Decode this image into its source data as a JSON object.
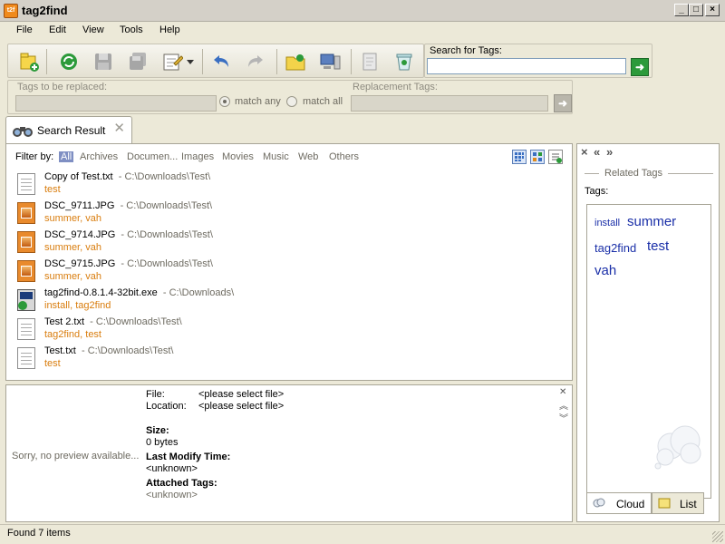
{
  "window": {
    "title": "tag2find",
    "controls": [
      "_",
      "□",
      "×"
    ]
  },
  "menu": {
    "items": [
      "File",
      "Edit",
      "View",
      "Tools",
      "Help"
    ]
  },
  "toolbar": {
    "buttons": [
      "new-tag-icon",
      "refresh-icon",
      "save-icon",
      "save-all-icon",
      "edit-icon",
      "undo-icon",
      "redo-icon",
      "open-folder-icon",
      "computer-icon",
      "document-icon",
      "recycle-bin-icon"
    ],
    "search_label": "Search for Tags:",
    "search_value": ""
  },
  "replace": {
    "tags_label": "Tags to be replaced:",
    "match_any": "match any",
    "match_all": "match all",
    "replacement_label": "Replacement Tags:"
  },
  "tab": {
    "label": "Search Result"
  },
  "filter": {
    "label": "Filter by:",
    "options": [
      "All",
      "Archives",
      "Documen...",
      "Images",
      "Movies",
      "Music",
      "Web",
      "Others"
    ]
  },
  "files": [
    {
      "name": "Copy of Test.txt",
      "path": "- C:\\Downloads\\Test\\",
      "tags": "test",
      "type": "txt"
    },
    {
      "name": "DSC_9711.JPG",
      "path": "- C:\\Downloads\\Test\\",
      "tags": "summer, vah",
      "type": "jpg"
    },
    {
      "name": "DSC_9714.JPG",
      "path": "- C:\\Downloads\\Test\\",
      "tags": "summer, vah",
      "type": "jpg"
    },
    {
      "name": "DSC_9715.JPG",
      "path": "- C:\\Downloads\\Test\\",
      "tags": "summer, vah",
      "type": "jpg"
    },
    {
      "name": "tag2find-0.8.1.4-32bit.exe",
      "path": "- C:\\Downloads\\",
      "tags": "install, tag2find",
      "type": "exe"
    },
    {
      "name": "Test 2.txt",
      "path": "- C:\\Downloads\\Test\\",
      "tags": "tag2find, test",
      "type": "txt"
    },
    {
      "name": "Test.txt",
      "path": "- C:\\Downloads\\Test\\",
      "tags": "test",
      "type": "txt"
    }
  ],
  "details": {
    "no_preview": "Sorry, no preview available...",
    "file_label": "File:",
    "file_value": "<please select file>",
    "location_label": "Location:",
    "location_value": "<please select file>",
    "size_label": "Size:",
    "size_value": "0 bytes",
    "modify_label": "Last Modify Time:",
    "modify_value": "<unknown>",
    "tags_label": "Attached Tags:",
    "tags_value": "<unknown>"
  },
  "related": {
    "controls": [
      "×",
      "«",
      "»"
    ],
    "title": "Related Tags",
    "tags_label": "Tags:",
    "cloud": [
      {
        "text": "install",
        "size": "small"
      },
      {
        "text": "summer",
        "size": "large"
      },
      {
        "text": "tag2find",
        "size": "medium"
      },
      {
        "text": "test",
        "size": "large"
      },
      {
        "text": "vah",
        "size": "large"
      }
    ],
    "tabs": [
      "Cloud",
      "List"
    ]
  },
  "status": {
    "text": "Found 7 items"
  },
  "colors": {
    "tag_orange": "#d97d0e",
    "cloud_blue": "#1a2fa8",
    "filter_active": "#7f8fc3"
  }
}
